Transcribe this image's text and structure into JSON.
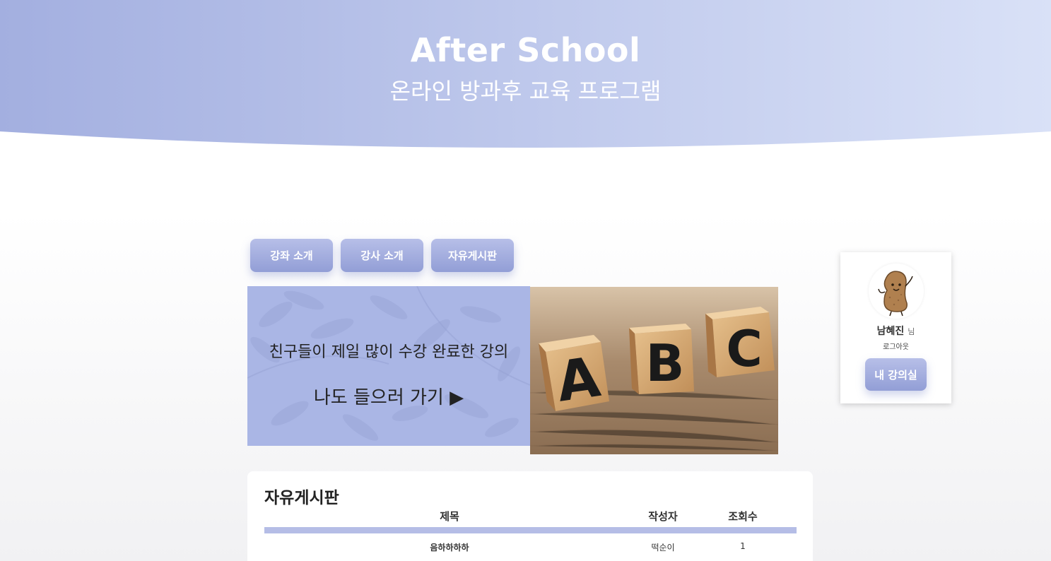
{
  "header": {
    "title": "After School",
    "subtitle": "온라인 방과후 교육 프로그램"
  },
  "nav": {
    "items": [
      {
        "label": "강좌 소개"
      },
      {
        "label": "강사 소개"
      },
      {
        "label": "자유게시판"
      }
    ]
  },
  "banner": {
    "line1": "친구들이 제일 많이 수강 완료한 강의",
    "line2": "나도 들으러 가기 ▶",
    "blocks": [
      "A",
      "B",
      "C"
    ]
  },
  "profile": {
    "name": "남혜진",
    "suffix": "님",
    "logout": "로그아웃",
    "classroom_button": "내 강의실"
  },
  "board": {
    "title": "자유게시판",
    "columns": [
      "제목",
      "작성자",
      "조회수"
    ],
    "rows": [
      {
        "title": "음하하하하",
        "author": "떡순이",
        "views": "1"
      }
    ]
  },
  "colors": {
    "header_gradient_start": "#a3afe0",
    "header_gradient_end": "#d9e1f7",
    "button_gradient_top": "#b7bfe8",
    "button_gradient_bottom": "#929ed6",
    "banner_panel": "#aab6e5"
  }
}
